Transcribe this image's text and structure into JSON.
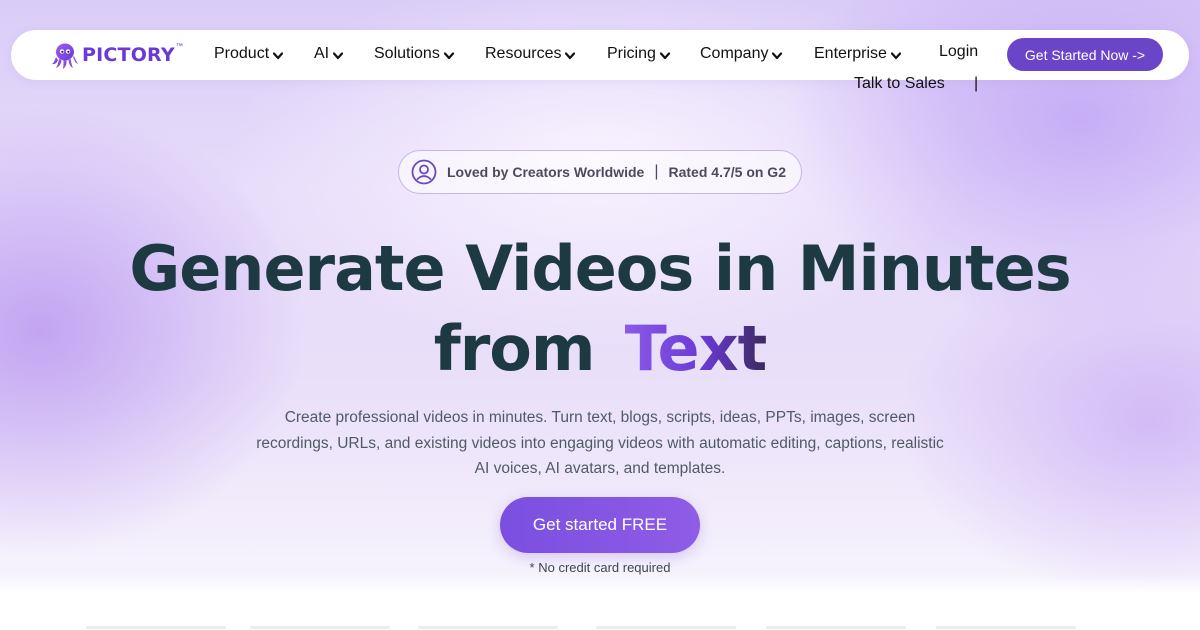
{
  "brand": {
    "name": "PICTORY",
    "trademark": "™",
    "logo_icon": "octopus-icon",
    "accent_color": "#6b3ad6"
  },
  "nav": {
    "items": [
      {
        "label": "Product"
      },
      {
        "label": "AI"
      },
      {
        "label": "Solutions"
      },
      {
        "label": "Resources"
      },
      {
        "label": "Pricing"
      },
      {
        "label": "Company"
      },
      {
        "label": "Enterprise"
      }
    ],
    "chevron_icon": "chevron-down-icon",
    "login": "Login",
    "cta": "Get Started Now ->",
    "talk_to_sales": "Talk to Sales",
    "separator": "|"
  },
  "badge": {
    "icon": "user-circle-icon",
    "loved": "Loved by Creators Worldwide",
    "separator": "|",
    "rating": "Rated 4.7/5 on G2"
  },
  "hero": {
    "headline_line1": "Generate Videos in Minutes",
    "headline_line2_prefix": "from",
    "headline_line2_accent": "Text",
    "subcopy": "Create professional videos in minutes. Turn text, blogs, scripts, ideas, PPTs, images, screen recordings, URLs, and existing videos into engaging videos with automatic editing, captions, realistic AI voices, AI avatars, and templates.",
    "cta": "Get started FREE",
    "note": "* No credit card required"
  }
}
